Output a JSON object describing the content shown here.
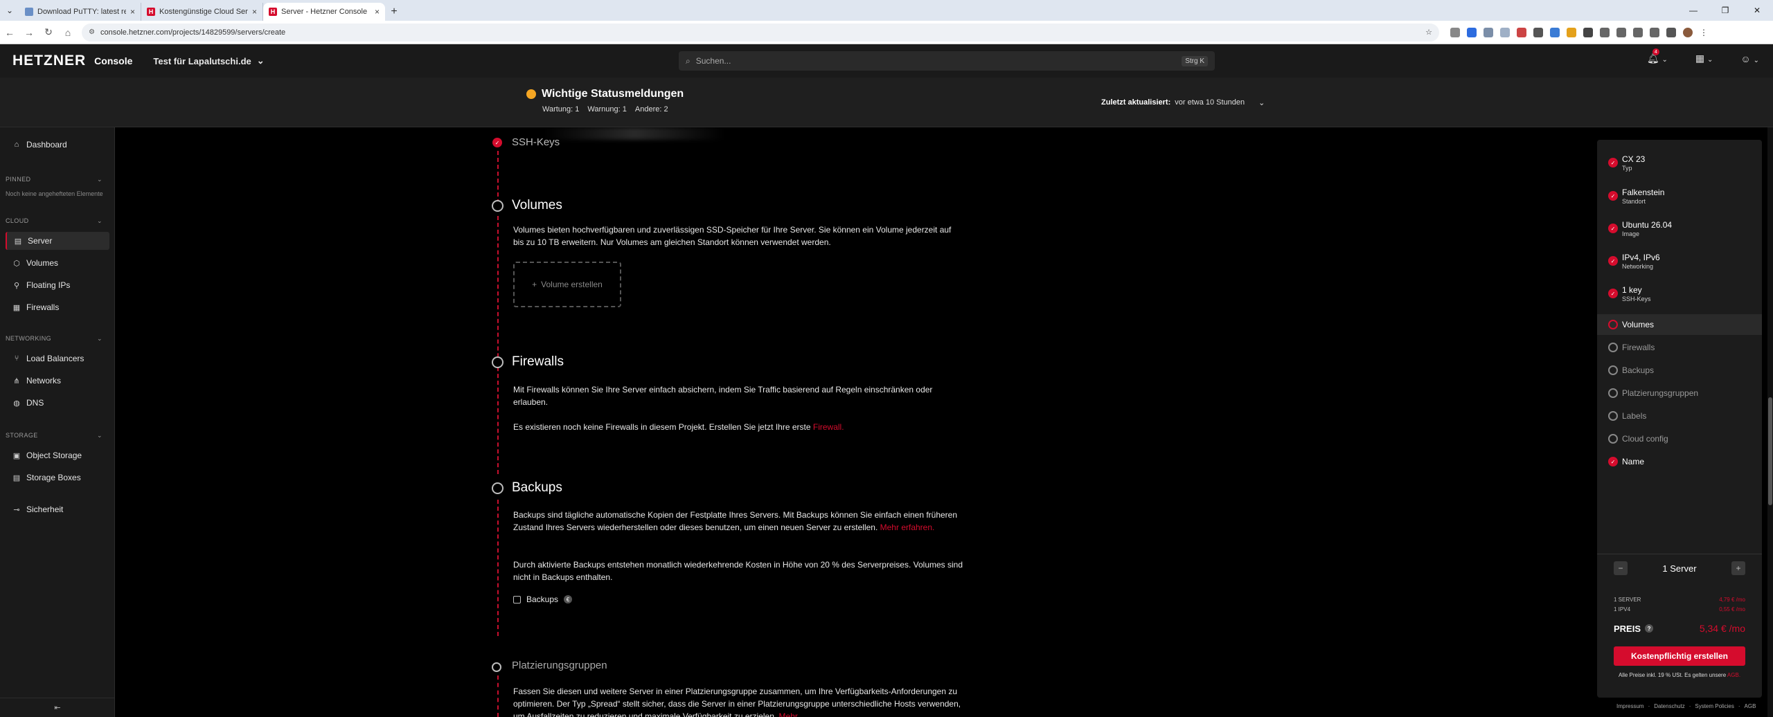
{
  "browser": {
    "tabs": [
      {
        "title": "Download PuTTY: latest release",
        "icon": "putty-icon",
        "active": false
      },
      {
        "title": "Kostengünstige Cloud Server | H",
        "icon": "hetzner-icon",
        "active": false
      },
      {
        "title": "Server - Hetzner Console",
        "icon": "hetzner-icon",
        "active": true
      }
    ],
    "url": "console.hetzner.com/projects/14829599/servers/create"
  },
  "topbar": {
    "logo": "HETZNER",
    "console_label": "Console",
    "project": "Test für Lapalutschi.de",
    "search_placeholder": "Suchen...",
    "search_shortcut": "Strg K",
    "notification_count": "4"
  },
  "status": {
    "title": "Wichtige Statusmeldungen",
    "wartung": "Wartung: 1",
    "warnung": "Warnung: 1",
    "andere": "Andere: 2",
    "updated_label": "Zuletzt aktualisiert:",
    "updated_value": "vor etwa 10 Stunden"
  },
  "sidebar": {
    "dashboard": "Dashboard",
    "pinned_label": "PINNED",
    "pinned_note": "Noch keine angehefteten Elemente",
    "cloud_label": "CLOUD",
    "cloud_items": [
      "Server",
      "Volumes",
      "Floating IPs",
      "Firewalls"
    ],
    "networking_label": "NETWORKING",
    "networking_items": [
      "Load Balancers",
      "Networks",
      "DNS"
    ],
    "storage_label": "STORAGE",
    "storage_items": [
      "Object Storage",
      "Storage Boxes"
    ],
    "security": "Sicherheit"
  },
  "main": {
    "ssh_title": "SSH-Keys",
    "volumes_title": "Volumes",
    "volumes_text": "Volumes bieten hochverfügbaren und zuverlässigen SSD-Speicher für Ihre Server. Sie können ein Volume jederzeit auf bis zu 10 TB erweitern. Nur Volumes am gleichen Standort können verwendet werden.",
    "volume_button": "Volume erstellen",
    "firewalls_title": "Firewalls",
    "firewalls_text": "Mit Firewalls können Sie Ihre Server einfach absichern, indem Sie Traffic basierend auf Regeln einschränken oder erlauben.",
    "firewalls_text2": "Es existieren noch keine Firewalls in diesem Projekt. Erstellen Sie jetzt Ihre erste",
    "firewalls_link": "Firewall.",
    "backups_title": "Backups",
    "backups_text": "Backups sind tägliche automatische Kopien der Festplatte Ihres Servers. Mit Backups können Sie einfach einen früheren Zustand Ihres Servers wiederherstellen oder dieses benutzen, um einen neuen Server zu erstellen.",
    "backups_link": "Mehr erfahren.",
    "backups_text2": "Durch aktivierte Backups entstehen monatlich wiederkehrende Kosten in Höhe von 20 % des Serverpreises. Volumes sind nicht in Backups enthalten.",
    "backups_checkbox": "Backups",
    "placement_title": "Platzierungsgruppen",
    "placement_text": "Fassen Sie diesen und weitere Server in einer Platzierungsgruppe zusammen, um Ihre Verfügbarkeits-Anforderungen zu optimieren. Der Typ „Spread“ stellt sicher, dass die Server in einer Platzierungsgruppe unterschiedliche Hosts verwenden, um Ausfallzeiten zu reduzieren und maximale Verfügbarkeit zu erzielen.",
    "placement_link": "Mehr"
  },
  "summary": {
    "done": [
      {
        "main": "CX 23",
        "sub": "Typ"
      },
      {
        "main": "Falkenstein",
        "sub": "Standort"
      },
      {
        "main": "Ubuntu 26.04",
        "sub": "Image"
      },
      {
        "main": "IPv4, IPv6",
        "sub": "Networking"
      },
      {
        "main": "1 key",
        "sub": "SSH-Keys"
      }
    ],
    "current": "Volumes",
    "pending": [
      "Firewalls",
      "Backups",
      "Platzierungsgruppen",
      "Labels",
      "Cloud config"
    ],
    "name": "Name",
    "server_count": "1 Server",
    "line1_label": "1 SERVER",
    "line1_value": "4,79 € /mo",
    "line2_label": "1 IPV4",
    "line2_value": "0,55 € /mo",
    "price_label": "PREIS",
    "price_value": "5,34 € /mo",
    "create_button": "Kostenpflichtig erstellen",
    "vat_note": "Alle Preise inkl. 19 % USt. Es gelten unsere",
    "vat_link": "AGB."
  },
  "footer": [
    "Impressum",
    "Datenschutz",
    "System Policies",
    "AGB"
  ],
  "colors": {
    "accent": "#d50c2d",
    "warning": "#f5a623"
  }
}
